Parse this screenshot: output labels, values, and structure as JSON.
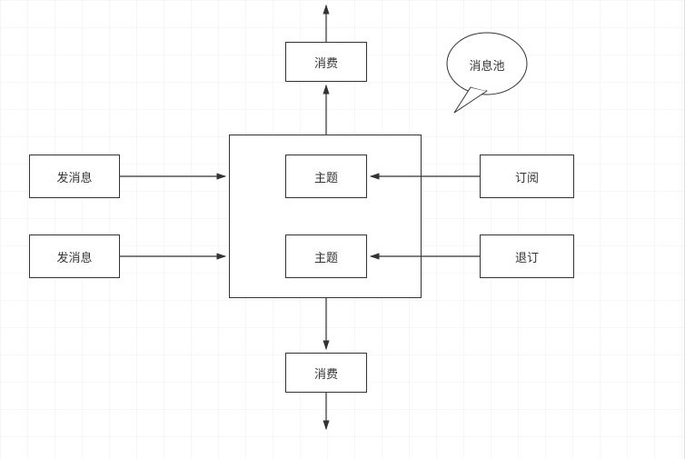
{
  "diagram": {
    "speech_label": "消息池",
    "consume_top": "消费",
    "consume_bottom": "消费",
    "send_message_1": "发消息",
    "send_message_2": "发消息",
    "topic_1": "主题",
    "topic_2": "主题",
    "subscribe": "订阅",
    "unsubscribe": "退订"
  }
}
